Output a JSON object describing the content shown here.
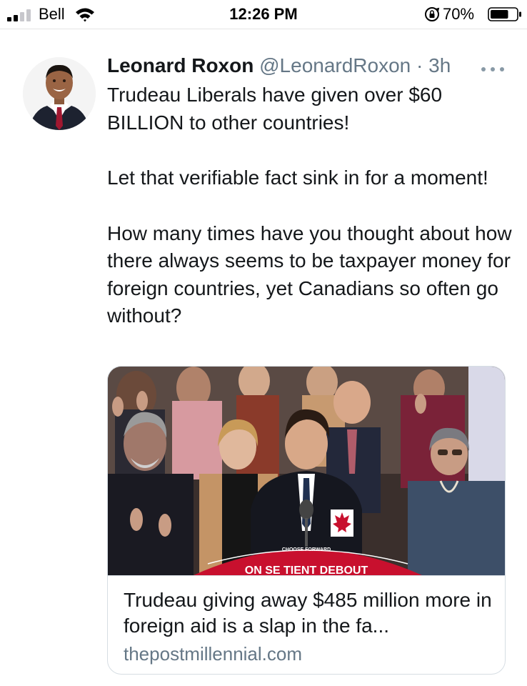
{
  "status_bar": {
    "carrier": "Bell",
    "time": "12:26 PM",
    "battery_percent": "70%",
    "battery_level": 0.7,
    "signal_icon": "signal-bars-icon",
    "wifi_icon": "wifi-icon",
    "rotation_lock_icon": "rotation-lock-icon"
  },
  "tweet": {
    "author_name": "Leonard Roxon",
    "handle": "@LeonardRoxon",
    "separator": "·",
    "time_ago": "3h",
    "more_icon": "more-dots-icon",
    "paragraphs": [
      "Trudeau Liberals have given over $60 BILLION to other countries!",
      "Let that verifiable fact sink in for a moment!",
      "How many times have you thought about how there always seems to be taxpayer money for foreign countries, yet Canadians so often go without?"
    ]
  },
  "link_card": {
    "image_banner_text": "ON SE TIENT DEBOUT",
    "image_slogan_text": "CHOOSE FORWARD",
    "title": "Trudeau giving away $485 million more in foreign aid is a slap in the fa...",
    "domain": "thepostmillennial.com"
  },
  "colors": {
    "text_primary": "#14171a",
    "text_secondary": "#657786",
    "card_border": "#d6dde3",
    "banner_red": "#c8102e"
  }
}
